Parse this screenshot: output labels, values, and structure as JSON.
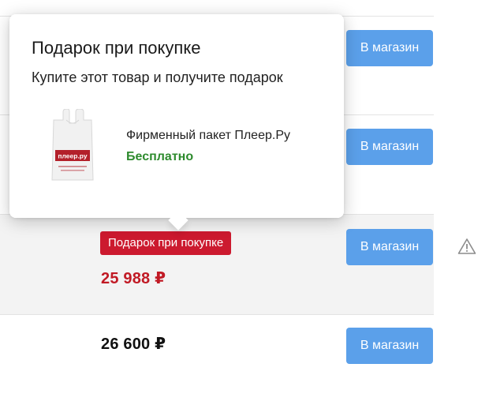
{
  "shop_button_label": "В магазин",
  "offers": [
    {
      "price": ""
    },
    {
      "price": ""
    },
    {
      "badge": "Подарок при покупке",
      "price": "25 988 ₽"
    },
    {
      "price": "26 600 ₽"
    }
  ],
  "popup": {
    "title": "Подарок при покупке",
    "subtitle": "Купите этот товар и получите подарок",
    "gift_name": "Фирменный пакет Плеер.Ру",
    "gift_price": "Бесплатно",
    "gift_bag_logo": "плеер.ру"
  },
  "icons": {
    "warning": "warning-icon"
  },
  "colors": {
    "button": "#5ba0ea",
    "badge": "#cc1a2f",
    "sale_price": "#c11a25",
    "free_text": "#2e8b2e",
    "highlight_row": "#f3f3f3"
  }
}
